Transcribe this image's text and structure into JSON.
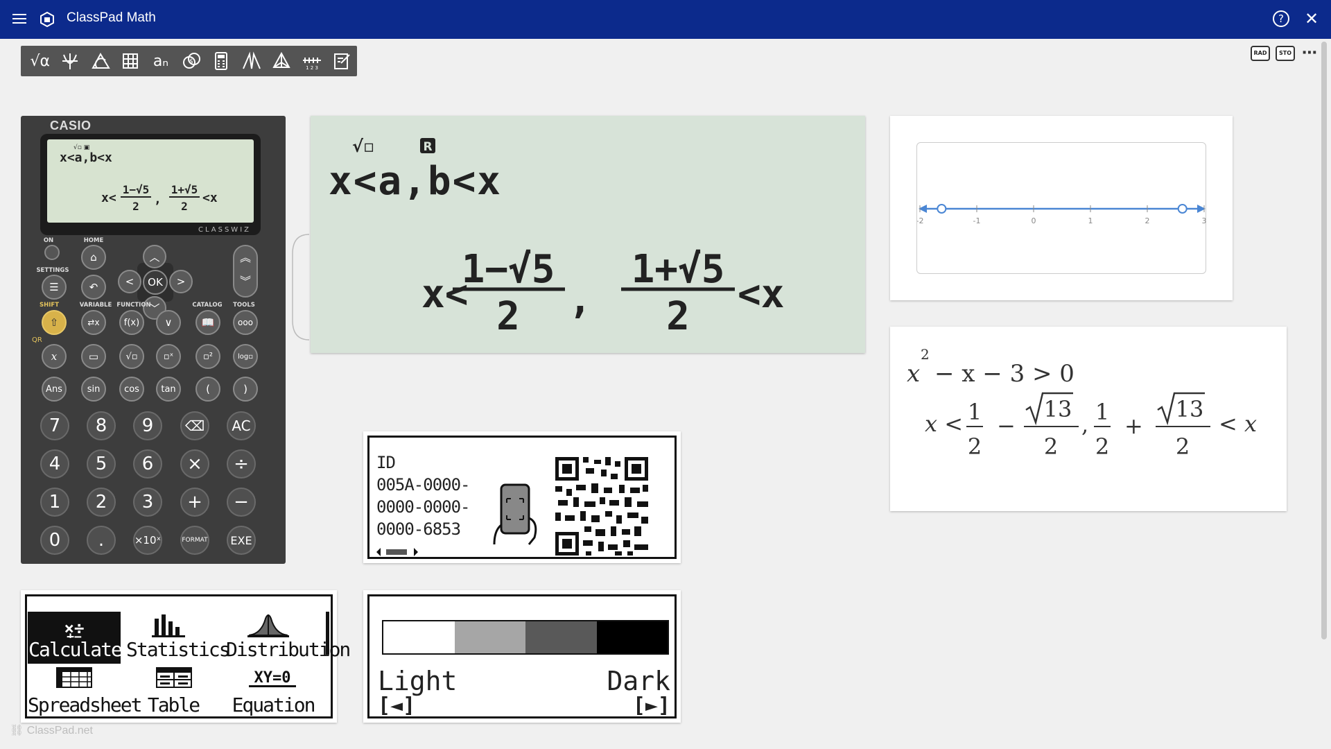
{
  "app": {
    "title": "ClassPad Math"
  },
  "toolbar": {
    "items": [
      "math-input",
      "graph",
      "geometry",
      "table",
      "sequence",
      "financial",
      "calculator",
      "statistics",
      "3d-geometry",
      "number-line",
      "notepad"
    ]
  },
  "top_right": {
    "rad": "RAD",
    "std": "STO",
    "more": "⋯"
  },
  "calculator": {
    "brand": "CASIO",
    "model": "CLASSWIZ",
    "screen_line1": "x<a,b<x",
    "screen_icons": "√ R",
    "labels": {
      "on": "ON",
      "home": "HOME",
      "settings": "SETTINGS",
      "shift": "SHIFT",
      "variable": "VARIABLE",
      "function": "FUNCTION",
      "catalog": "CATALOG",
      "tools": "TOOLS",
      "qr": "QR"
    },
    "keys_row3": [
      "Ans",
      "sin",
      "cos",
      "tan",
      "(",
      ")"
    ],
    "keys_num1": [
      "7",
      "8",
      "9",
      "⌫",
      "AC"
    ],
    "keys_num2": [
      "4",
      "5",
      "6",
      "×",
      "÷"
    ],
    "keys_num3": [
      "1",
      "2",
      "3",
      "+",
      "−"
    ],
    "keys_num4": [
      "0",
      ".",
      "×10ˣ",
      "FORMAT",
      "EXE"
    ],
    "ok": "OK"
  },
  "big_screen": {
    "line1": "x<a,b<x",
    "lhs": "x<",
    "frac1_num": "1−√5",
    "frac1_den": "2",
    "sep": ",",
    "frac2_num": "1+√5",
    "frac2_den": "2",
    "rhs": "<x"
  },
  "number_line": {
    "ticks": [
      "-2",
      "-1",
      "0",
      "1",
      "2",
      "3"
    ],
    "open_points": [
      -1.618,
      2.618
    ]
  },
  "math": {
    "inequality": "x² − x − 3 > 0",
    "ineq_lhs": "x",
    "ineq_exp": "2",
    "ineq_rest": "− x − 3 > 0",
    "solution_x": "x <",
    "half": "1",
    "two": "2",
    "minus": "−",
    "plus": "+",
    "sqrt13": "13",
    "comma": ",",
    "end": "< x"
  },
  "qr_screen": {
    "id_label": "ID",
    "id_lines": [
      "005A-0000-",
      "0000-0000-",
      "0000-6853"
    ]
  },
  "menu_screen": {
    "items": [
      "Calculate",
      "Statistics",
      "Distribution",
      "Spreadsheet",
      "Table",
      "Equation"
    ]
  },
  "contrast_screen": {
    "light": "Light",
    "dark": "Dark",
    "left_hint": "[◄]",
    "right_hint": "[►]",
    "swatches": [
      "#ffffff",
      "#a6a6a6",
      "#595959",
      "#000000"
    ]
  },
  "footer": {
    "text": "ClassPad.net"
  }
}
